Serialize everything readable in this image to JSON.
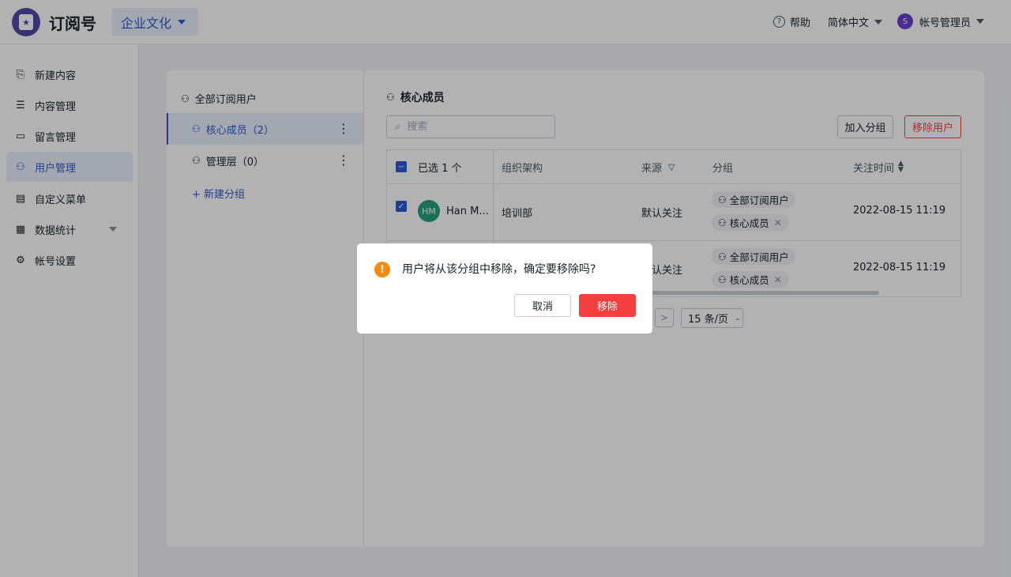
{
  "header": {
    "app_title": "订阅号",
    "logo_glyph": "★",
    "account_selector": "企业文化",
    "help_label": "帮助",
    "language": "简体中文",
    "user_initial": "S",
    "user_name": "帐号管理员"
  },
  "sidebar": {
    "items": [
      {
        "label": "新建内容",
        "icon": "new-doc-icon",
        "glyph": "⎘"
      },
      {
        "label": "内容管理",
        "icon": "document-icon",
        "glyph": "☰"
      },
      {
        "label": "留言管理",
        "icon": "comment-icon",
        "glyph": "▭"
      },
      {
        "label": "用户管理",
        "icon": "users-icon",
        "glyph": "⚇",
        "active": true
      },
      {
        "label": "自定义菜单",
        "icon": "menu-icon",
        "glyph": "▤"
      },
      {
        "label": "数据统计",
        "icon": "chart-icon",
        "glyph": "▦"
      },
      {
        "label": "帐号设置",
        "icon": "gear-icon",
        "glyph": "⚙"
      }
    ]
  },
  "groups": {
    "all_label": "全部订阅用户",
    "items": [
      {
        "label": "核心成员（2）",
        "active": true
      },
      {
        "label": "管理层（0）"
      }
    ],
    "new_group_label": "+ 新建分组",
    "more_glyph": "⋮"
  },
  "content": {
    "title": "核心成员",
    "search_placeholder": "搜索",
    "add_to_group_label": "加入分组",
    "remove_user_label": "移除用户",
    "table": {
      "columns": [
        "已选 1 个",
        "组织架构",
        "来源",
        "分组",
        "关注时间"
      ],
      "rows": [
        {
          "avatar": "HM",
          "name": "Han M...",
          "org": "培训部",
          "source": "默认关注",
          "groups": [
            "全部订阅用户",
            "核心成员"
          ],
          "time": "2022-08-15 11:19"
        },
        {
          "org": "",
          "source": "默认关注",
          "groups": [
            "全部订阅用户",
            "核心成员"
          ],
          "time": "2022-08-15 11:19"
        }
      ]
    },
    "pager": {
      "next_glyph": ">",
      "page_size": "15 条/页"
    }
  },
  "modal": {
    "message": "用户将从该分组中移除，确定要移除吗?",
    "cancel_label": "取消",
    "confirm_label": "移除"
  },
  "colors": {
    "primary": "#2b5cd1",
    "danger": "#f53f3f",
    "warning": "#f7890e"
  }
}
